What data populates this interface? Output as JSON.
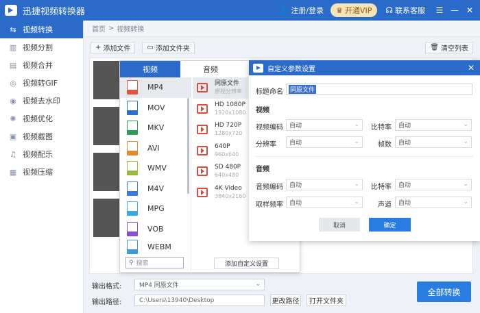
{
  "titlebar": {
    "title": "迅捷视频转换器",
    "login": "注册/登录",
    "vip": "开通VIP",
    "support": "联系客服"
  },
  "sidebar": {
    "items": [
      {
        "label": "视频转换",
        "icon": "swap-icon"
      },
      {
        "label": "视频分割",
        "icon": "split-icon"
      },
      {
        "label": "视频合并",
        "icon": "merge-icon"
      },
      {
        "label": "视频转GIF",
        "icon": "gif-icon"
      },
      {
        "label": "视频去水印",
        "icon": "watermark-icon"
      },
      {
        "label": "视频优化",
        "icon": "optimize-icon"
      },
      {
        "label": "视频截图",
        "icon": "screenshot-icon"
      },
      {
        "label": "视频配乐",
        "icon": "music-icon"
      },
      {
        "label": "视频压缩",
        "icon": "compress-icon"
      }
    ]
  },
  "breadcrumb": {
    "home": "首页",
    "current": "视频转换"
  },
  "toolbar": {
    "add_file": "添加文件",
    "add_folder": "添加文件夹",
    "clear_list": "清空列表"
  },
  "bottom": {
    "format_label": "输出格式:",
    "format_value": "MP4  同原文件",
    "path_label": "输出路径:",
    "path_value": "C:\\Users\\13940\\Desktop",
    "change_path": "更改路径",
    "open_folder": "打开文件夹",
    "convert_all": "全部转换"
  },
  "format_popup": {
    "tab_video": "视频",
    "tab_audio": "音频",
    "formats": [
      {
        "name": "MP4",
        "color": "#e2553f"
      },
      {
        "name": "MOV",
        "color": "#2e6fd0"
      },
      {
        "name": "MKV",
        "color": "#2f9a5a"
      },
      {
        "name": "AVI",
        "color": "#e58a2a"
      },
      {
        "name": "WMV",
        "color": "#9ab93a"
      },
      {
        "name": "M4V",
        "color": "#3b78d8"
      },
      {
        "name": "MPG",
        "color": "#3aa7e0"
      },
      {
        "name": "VOB",
        "color": "#8a4fd0"
      },
      {
        "name": "WEBM",
        "color": "#3a9bd6"
      }
    ],
    "qualities": [
      {
        "name": "同原文件",
        "sub": "原视分辨率"
      },
      {
        "name": "HD 1080P",
        "sub": "1920x1080"
      },
      {
        "name": "HD 720P",
        "sub": "1280x720"
      },
      {
        "name": "640P",
        "sub": "960x640"
      },
      {
        "name": "SD 480P",
        "sub": "640x480"
      },
      {
        "name": "4K Video",
        "sub": "3840x2160"
      }
    ],
    "search_placeholder": "搜索",
    "add_custom": "添加自定义设置"
  },
  "dialog": {
    "title": "自定义参数设置",
    "name_label": "标题命名",
    "name_value": "同原文件",
    "video_section": "视频",
    "video_codec_label": "视频编码",
    "video_bitrate_label": "比特率",
    "resolution_label": "分辨率",
    "fps_label": "帧数",
    "audio_section": "音频",
    "audio_codec_label": "音频编码",
    "audio_bitrate_label": "比特率",
    "samplerate_label": "取样频率",
    "channel_label": "声道",
    "auto": "自动",
    "cancel": "取消",
    "ok": "确定"
  }
}
